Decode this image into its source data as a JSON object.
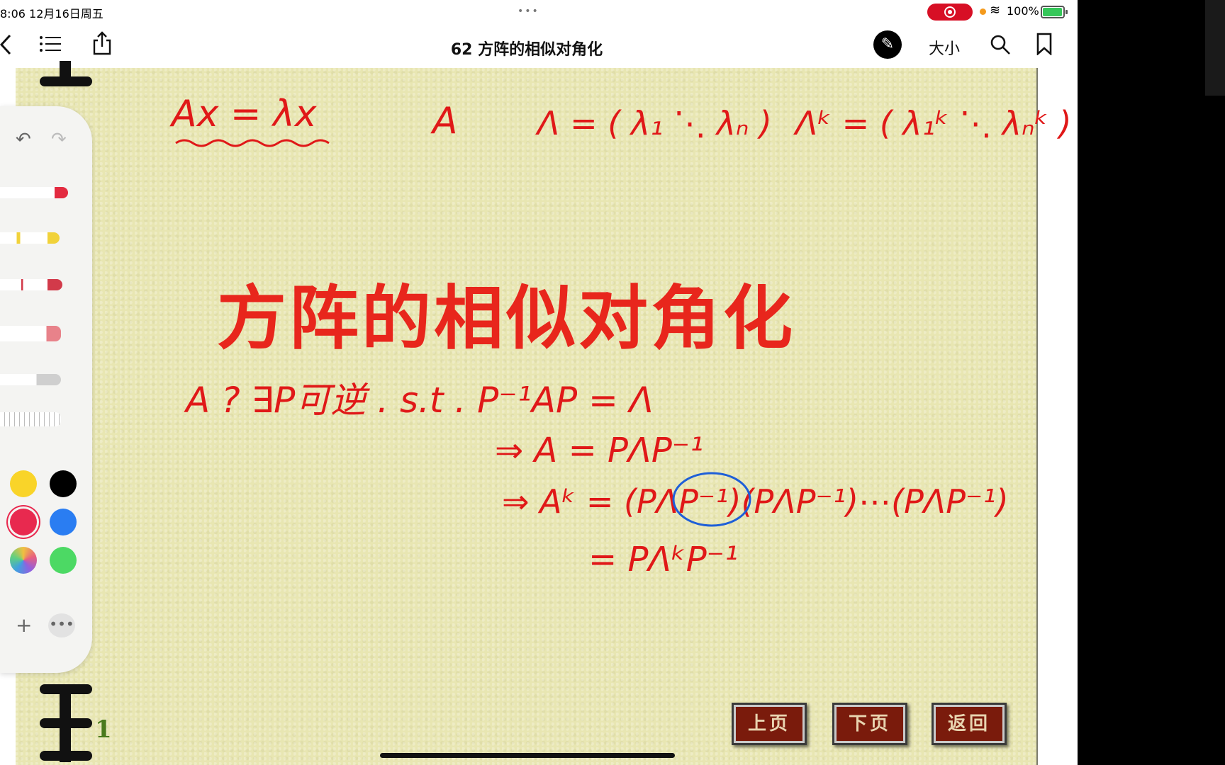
{
  "status_bar": {
    "time": "8:06",
    "date": "12月16日周五",
    "dots": "•••",
    "battery": "100%"
  },
  "nav": {
    "title": "62 方阵的相似对角化",
    "size_label": "大小",
    "icons": [
      "back-chevron-icon",
      "list-icon",
      "share-icon",
      "pen-circle-icon",
      "search-icon",
      "bookmark-icon"
    ]
  },
  "slide": {
    "title": "方阵的相似对角化",
    "page_number": "1",
    "buttons": {
      "prev": "上页",
      "next": "下页",
      "back": "返回"
    }
  },
  "handwriting": {
    "line1_a": "Ax = λx",
    "line1_b": "A",
    "line1_c": "Λ = ( λ₁ ⋱ λₙ )",
    "line1_d": "Λᵏ = ( λ₁ᵏ ⋱ λₙᵏ )",
    "line2": "A ?   ∃P可逆 . s.t . P⁻¹AP = Λ",
    "line3": "⇒ A = PΛP⁻¹",
    "line4": "⇒ Aᵏ = (PΛP⁻¹)(PΛP⁻¹)⋯(PΛP⁻¹)",
    "line5": "= PΛᵏP⁻¹"
  },
  "palette": {
    "colors": [
      {
        "name": "yellow",
        "hex": "#f9d429"
      },
      {
        "name": "black",
        "hex": "#000000"
      },
      {
        "name": "red",
        "hex": "#e8294f",
        "selected": true
      },
      {
        "name": "blue",
        "hex": "#2a7df2"
      },
      {
        "name": "spectrum",
        "hex": "#c08ad8"
      },
      {
        "name": "green",
        "hex": "#4cd964"
      }
    ]
  },
  "colors": {
    "ink_red": "#e01818",
    "ink_blue": "#1e5fd8",
    "title_red": "#e8261c",
    "paper": "#e8e6b2"
  }
}
